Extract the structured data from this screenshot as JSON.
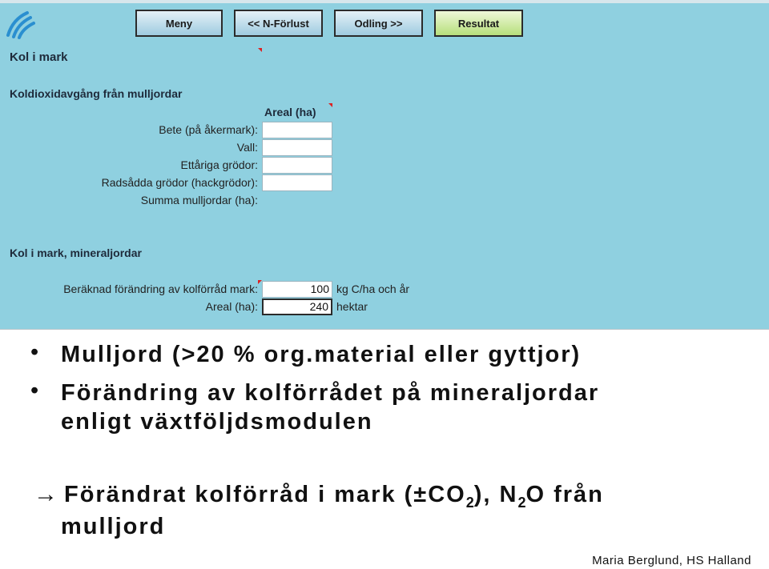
{
  "toolbar": {
    "meny_label": "Meny",
    "n_forlust_label": "<< N-Förlust",
    "odling_label": "Odling >>",
    "resultat_label": "Resultat"
  },
  "sheet": {
    "title": "Kol i mark",
    "section1": {
      "heading": "Koldioxidavgång från mulljordar",
      "column_header": "Areal (ha)",
      "rows": [
        {
          "label": "Bete (på åkermark):",
          "value": ""
        },
        {
          "label": "Vall:",
          "value": ""
        },
        {
          "label": "Ettåriga grödor:",
          "value": ""
        },
        {
          "label": "Radsådda grödor (hackgrödor):",
          "value": ""
        }
      ],
      "sum_label": "Summa mulljordar (ha):"
    },
    "section2": {
      "heading": "Kol i mark, mineraljordar",
      "row1_label": "Beräknad förändring av kolförråd mark:",
      "row1_value": "100",
      "row1_unit": "kg C/ha och år",
      "row2_label": "Areal (ha):",
      "row2_value": "240",
      "row2_unit": "hektar"
    }
  },
  "slide": {
    "bullet_char": "•",
    "bullet1": "Mulljord (>20 % org.material eller gyttjor)",
    "bullet2_line1": "Förändring av kolförrådet på mineraljordar",
    "bullet2_line2": "enligt växtföljdsmodulen",
    "arrow_char": "→",
    "conclusion_a": "Förändrat kolförråd i mark (±CO",
    "sub_2a": "2",
    "conclusion_b": "), N",
    "sub_2b": "2",
    "conclusion_c": "O från",
    "conclusion_line2": "mulljord",
    "footer": "Maria Berglund, HS Halland"
  }
}
